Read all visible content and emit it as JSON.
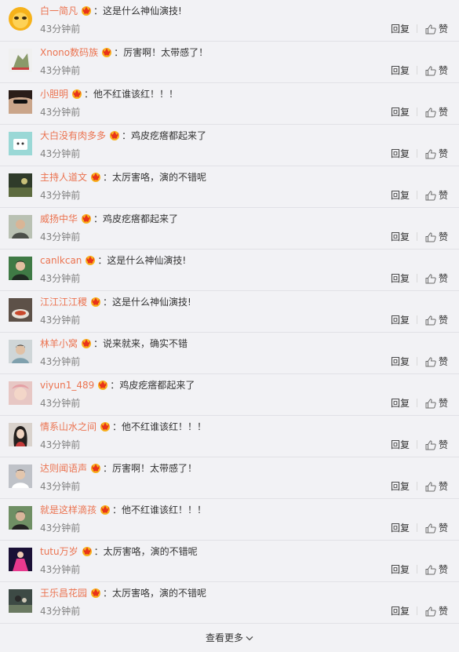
{
  "colors": {
    "username": "#eb7350",
    "time": "#808080",
    "background": "#f2f2f5"
  },
  "icons": {
    "badge": "vip-crown-icon",
    "like": "thumbs-up-icon",
    "more": "chevron-down-icon"
  },
  "actions": {
    "reply_label": "回复",
    "like_label": "赞"
  },
  "comments": [
    {
      "username": "白一简凡",
      "text": "这是什么神仙演技!",
      "time": "43分钟前"
    },
    {
      "username": "Xnono数码族",
      "text": "厉害啊！太带感了！",
      "time": "43分钟前"
    },
    {
      "username": "小胆明",
      "text": "他不红谁该红！！！",
      "time": "43分钟前"
    },
    {
      "username": "大白没有肉多多",
      "text": "鸡皮疙瘩都起来了",
      "time": "43分钟前"
    },
    {
      "username": "主持人道文",
      "text": "太厉害咯，演的不错呢",
      "time": "43分钟前"
    },
    {
      "username": "威扬中华",
      "text": "鸡皮疙瘩都起来了",
      "time": "43分钟前"
    },
    {
      "username": "canlkcan",
      "text": "这是什么神仙演技!",
      "time": "43分钟前"
    },
    {
      "username": "江江江江稷",
      "text": "这是什么神仙演技!",
      "time": "43分钟前"
    },
    {
      "username": "林羊小窝",
      "text": "说来就来，确实不错",
      "time": "43分钟前"
    },
    {
      "username": "viyun1_489",
      "text": "鸡皮疙瘩都起来了",
      "time": "43分钟前"
    },
    {
      "username": "情系山水之间",
      "text": "他不红谁该红！！！",
      "time": "43分钟前"
    },
    {
      "username": "达则闻语声",
      "text": "厉害啊！太带感了！",
      "time": "43分钟前"
    },
    {
      "username": "就是这样滴孩",
      "text": "他不红谁该红！！！",
      "time": "43分钟前"
    },
    {
      "username": "tutu万岁",
      "text": "太厉害咯，演的不错呢",
      "time": "43分钟前"
    },
    {
      "username": "王乐昌花园",
      "text": "太厉害咯，演的不错呢",
      "time": "43分钟前"
    }
  ],
  "footer": {
    "more_label": "查看更多"
  }
}
